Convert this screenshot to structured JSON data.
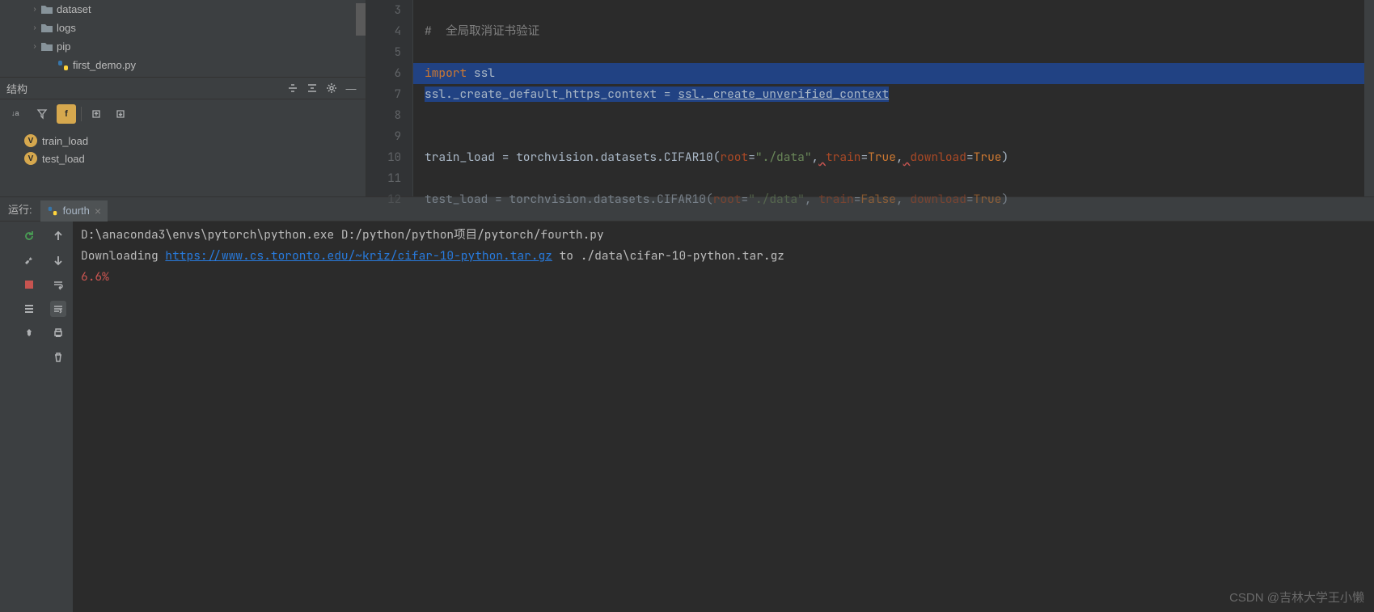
{
  "project_tree": {
    "items": [
      {
        "name": "dataset",
        "type": "folder",
        "indent": 1,
        "arrow": "›"
      },
      {
        "name": "logs",
        "type": "folder",
        "indent": 1,
        "arrow": "›"
      },
      {
        "name": "pip",
        "type": "folder",
        "indent": 1,
        "arrow": "›"
      },
      {
        "name": "first_demo.py",
        "type": "python",
        "indent": 2,
        "arrow": ""
      }
    ]
  },
  "structure": {
    "title": "结构",
    "items": [
      {
        "label": "train_load"
      },
      {
        "label": "test_load"
      }
    ]
  },
  "editor": {
    "lines": [
      3,
      4,
      5,
      6,
      7,
      8,
      9,
      10,
      11,
      12
    ],
    "code": {
      "l4_comment": "#  全局取消证书验证",
      "l6_import": "import",
      "l6_ssl": " ssl",
      "l7_a": "ssl._create_default_https_context = ",
      "l7_b": "ssl._create_unverified_context",
      "l10_a": "train_load = torchvision.datasets.CIFAR10(",
      "l10_root": "root",
      "l10_eq1": "=",
      "l10_str": "\"./data\"",
      "l10_c1": ",",
      "l10_sq1": " ",
      "l10_train": "train",
      "l10_eq2": "=",
      "l10_true1": "True",
      "l10_c2": ",",
      "l10_sq2": " ",
      "l10_dl": "download",
      "l10_eq3": "=",
      "l10_true2": "True",
      "l10_end": ")",
      "l12_a": "test_load = torchvision.datasets.CIFAR10(",
      "l12_root": "root",
      "l12_eq1": "=",
      "l12_str": "\"./data\"",
      "l12_c1": ",",
      "l12_train": "train",
      "l12_eq2": "=",
      "l12_false": "False",
      "l12_c2": ",",
      "l12_dl": "download",
      "l12_eq3": "=",
      "l12_true": "True",
      "l12_end": ")"
    }
  },
  "run": {
    "label": "运行:",
    "tab": "fourth",
    "console": {
      "line1": "D:\\anaconda3\\envs\\pytorch\\python.exe D:/python/python项目/pytorch/fourth.py",
      "line2_a": "Downloading ",
      "line2_link": "https://www.cs.toronto.edu/~kriz/cifar-10-python.tar.gz",
      "line2_b": " to ./data\\cifar-10-python.tar.gz",
      "line3": "6.6%"
    }
  },
  "watermark": "CSDN @吉林大学王小懒"
}
